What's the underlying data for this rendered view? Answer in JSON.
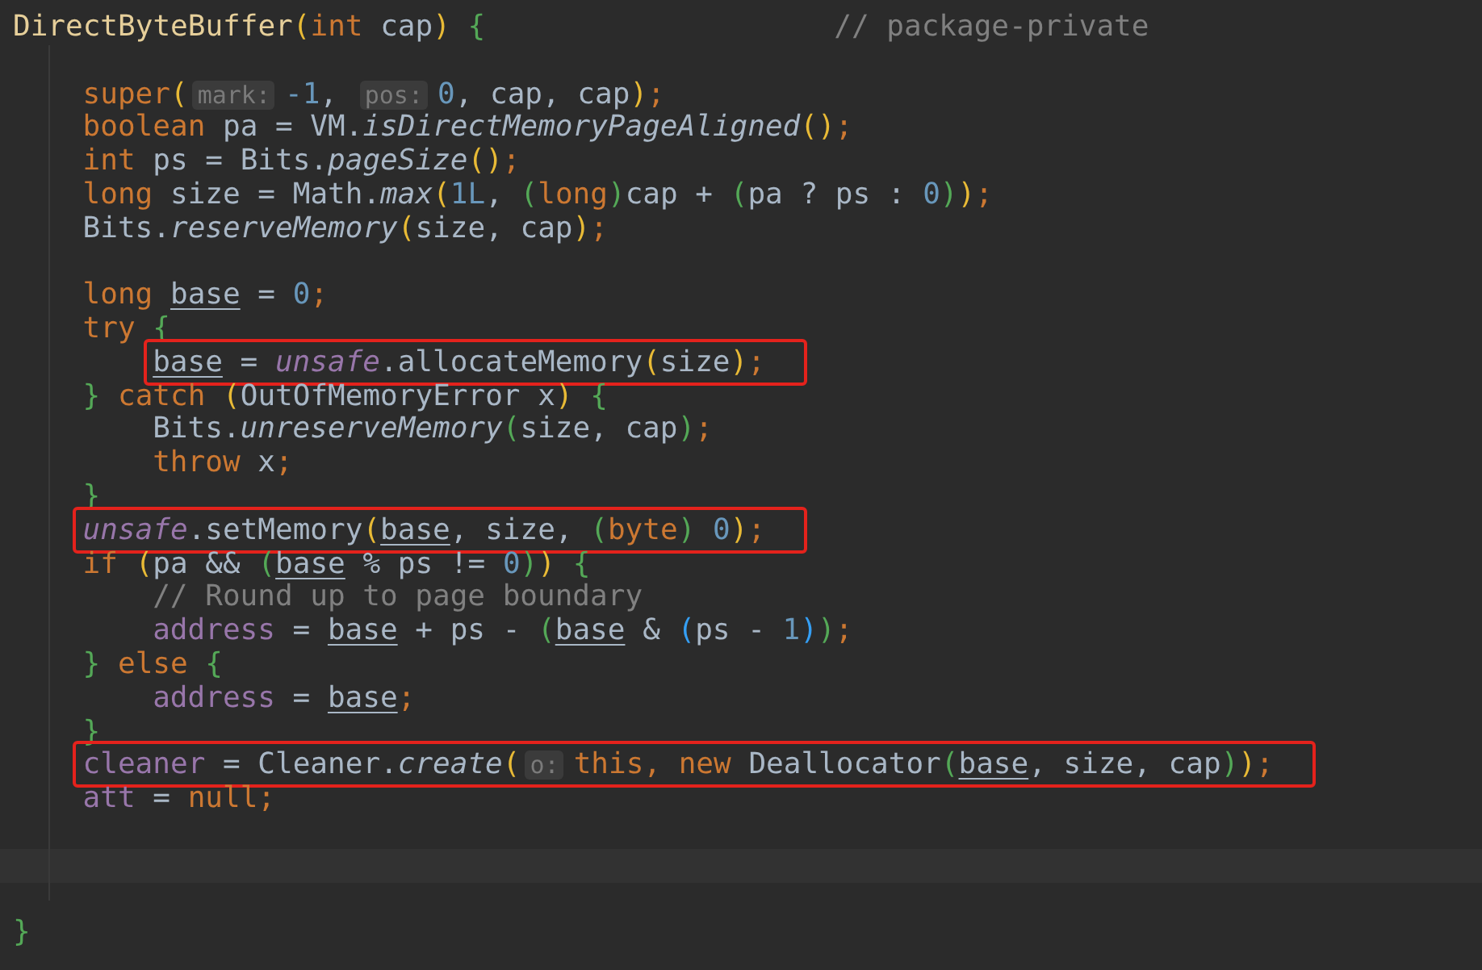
{
  "editor": {
    "lines": [
      {
        "kind": "code",
        "highlighted": false,
        "tokens": [
          {
            "kind": "fn",
            "text": "DirectByteBuffer"
          },
          {
            "kind": "b1",
            "text": "("
          },
          {
            "kind": "kw",
            "text": "int"
          },
          {
            "kind": "id",
            "text": " cap"
          },
          {
            "kind": "b1",
            "text": ")"
          },
          {
            "kind": "b2",
            "text": " {"
          }
        ],
        "comment": "// package-private",
        "children": [
          {
            "kind": "blank"
          },
          {
            "kind": "code",
            "highlighted": false,
            "tokens": [
              {
                "kind": "kw",
                "text": "super"
              },
              {
                "kind": "b1",
                "text": "("
              },
              {
                "kind": "hint",
                "text": "mark:"
              },
              {
                "kind": "num",
                "text": "-1"
              },
              {
                "kind": "id",
                "text": ", "
              },
              {
                "kind": "hint",
                "text": "pos:"
              },
              {
                "kind": "num",
                "text": "0"
              },
              {
                "kind": "id",
                "text": ", cap, cap"
              },
              {
                "kind": "b1",
                "text": ")"
              },
              {
                "kind": "kw",
                "text": ";"
              }
            ]
          },
          {
            "kind": "code",
            "highlighted": false,
            "tokens": [
              {
                "kind": "kw",
                "text": "boolean"
              },
              {
                "kind": "id",
                "text": " pa = VM."
              },
              {
                "kind": "ital",
                "text": "isDirectMemoryPageAligned"
              },
              {
                "kind": "b1",
                "text": "()"
              },
              {
                "kind": "kw",
                "text": ";"
              }
            ]
          },
          {
            "kind": "code",
            "highlighted": false,
            "tokens": [
              {
                "kind": "kw",
                "text": "int"
              },
              {
                "kind": "id",
                "text": " ps = Bits."
              },
              {
                "kind": "ital",
                "text": "pageSize"
              },
              {
                "kind": "b1",
                "text": "()"
              },
              {
                "kind": "kw",
                "text": ";"
              }
            ]
          },
          {
            "kind": "code",
            "highlighted": false,
            "tokens": [
              {
                "kind": "kw",
                "text": "long"
              },
              {
                "kind": "id",
                "text": " size = Math."
              },
              {
                "kind": "ital",
                "text": "max"
              },
              {
                "kind": "b1",
                "text": "("
              },
              {
                "kind": "num",
                "text": "1L"
              },
              {
                "kind": "id",
                "text": ", "
              },
              {
                "kind": "b2",
                "text": "("
              },
              {
                "kind": "kw",
                "text": "long"
              },
              {
                "kind": "b2",
                "text": ")"
              },
              {
                "kind": "id",
                "text": "cap + "
              },
              {
                "kind": "b2",
                "text": "("
              },
              {
                "kind": "id",
                "text": "pa ? ps : "
              },
              {
                "kind": "num",
                "text": "0"
              },
              {
                "kind": "b2",
                "text": ")"
              },
              {
                "kind": "b1",
                "text": ")"
              },
              {
                "kind": "kw",
                "text": ";"
              }
            ]
          },
          {
            "kind": "code",
            "highlighted": false,
            "tokens": [
              {
                "kind": "id",
                "text": "Bits."
              },
              {
                "kind": "ital",
                "text": "reserveMemory"
              },
              {
                "kind": "b1",
                "text": "("
              },
              {
                "kind": "id",
                "text": "size, cap"
              },
              {
                "kind": "b1",
                "text": ")"
              },
              {
                "kind": "kw",
                "text": ";"
              }
            ]
          },
          {
            "kind": "blank"
          },
          {
            "kind": "code",
            "highlighted": false,
            "tokens": [
              {
                "kind": "kw",
                "text": "long "
              },
              {
                "kind": "under",
                "text": "base"
              },
              {
                "kind": "id",
                "text": " = "
              },
              {
                "kind": "num",
                "text": "0"
              },
              {
                "kind": "kw",
                "text": ";"
              }
            ]
          },
          {
            "kind": "code",
            "highlighted": false,
            "tokens": [
              {
                "kind": "kw",
                "text": "try"
              },
              {
                "kind": "b2",
                "text": " {"
              }
            ],
            "children": [
              {
                "kind": "code",
                "highlighted": true,
                "tokens": [
                  {
                    "kind": "under",
                    "text": "base"
                  },
                  {
                    "kind": "id",
                    "text": " = "
                  },
                  {
                    "kind": "fieldital",
                    "text": "unsafe"
                  },
                  {
                    "kind": "id",
                    "text": ".allocateMemory"
                  },
                  {
                    "kind": "b1",
                    "text": "("
                  },
                  {
                    "kind": "id",
                    "text": "size"
                  },
                  {
                    "kind": "b1",
                    "text": ")"
                  },
                  {
                    "kind": "kw",
                    "text": ";"
                  }
                ]
              }
            ]
          },
          {
            "kind": "code",
            "highlighted": false,
            "tokens": [
              {
                "kind": "b2",
                "text": "}"
              },
              {
                "kind": "kw",
                "text": " catch"
              },
              {
                "kind": "b1",
                "text": " ("
              },
              {
                "kind": "id",
                "text": "OutOfMemoryError x"
              },
              {
                "kind": "b1",
                "text": ")"
              },
              {
                "kind": "b2",
                "text": " {"
              }
            ],
            "children": [
              {
                "kind": "code",
                "highlighted": false,
                "tokens": [
                  {
                    "kind": "id",
                    "text": "Bits."
                  },
                  {
                    "kind": "ital",
                    "text": "unreserveMemory"
                  },
                  {
                    "kind": "b2",
                    "text": "("
                  },
                  {
                    "kind": "id",
                    "text": "size, cap"
                  },
                  {
                    "kind": "b2",
                    "text": ")"
                  },
                  {
                    "kind": "kw",
                    "text": ";"
                  }
                ]
              },
              {
                "kind": "code",
                "highlighted": false,
                "tokens": [
                  {
                    "kind": "kw",
                    "text": "throw"
                  },
                  {
                    "kind": "id",
                    "text": " x"
                  },
                  {
                    "kind": "kw",
                    "text": ";"
                  }
                ]
              }
            ]
          },
          {
            "kind": "code",
            "highlighted": false,
            "tokens": [
              {
                "kind": "b2",
                "text": "}"
              }
            ]
          },
          {
            "kind": "code",
            "highlighted": true,
            "tokens": [
              {
                "kind": "fieldital",
                "text": "unsafe"
              },
              {
                "kind": "id",
                "text": ".setMemory"
              },
              {
                "kind": "b1",
                "text": "("
              },
              {
                "kind": "under",
                "text": "base"
              },
              {
                "kind": "id",
                "text": ", size, "
              },
              {
                "kind": "b2",
                "text": "("
              },
              {
                "kind": "kw",
                "text": "byte"
              },
              {
                "kind": "b2",
                "text": ")"
              },
              {
                "kind": "num",
                "text": " 0"
              },
              {
                "kind": "b1",
                "text": ")"
              },
              {
                "kind": "kw",
                "text": ";"
              }
            ]
          },
          {
            "kind": "code",
            "highlighted": false,
            "tokens": [
              {
                "kind": "kw",
                "text": "if"
              },
              {
                "kind": "b1",
                "text": " ("
              },
              {
                "kind": "id",
                "text": "pa && "
              },
              {
                "kind": "b2",
                "text": "("
              },
              {
                "kind": "under",
                "text": "base"
              },
              {
                "kind": "id",
                "text": " % ps != "
              },
              {
                "kind": "num",
                "text": "0"
              },
              {
                "kind": "b2",
                "text": ")"
              },
              {
                "kind": "b1",
                "text": ")"
              },
              {
                "kind": "b2",
                "text": " {"
              }
            ],
            "children": [
              {
                "kind": "code",
                "highlighted": false,
                "tokens": [
                  {
                    "kind": "comment",
                    "text": "// Round up to page boundary"
                  }
                ]
              },
              {
                "kind": "code",
                "highlighted": false,
                "tokens": [
                  {
                    "kind": "field",
                    "text": "address"
                  },
                  {
                    "kind": "id",
                    "text": " = "
                  },
                  {
                    "kind": "under",
                    "text": "base"
                  },
                  {
                    "kind": "id",
                    "text": " + ps - "
                  },
                  {
                    "kind": "b2",
                    "text": "("
                  },
                  {
                    "kind": "under",
                    "text": "base"
                  },
                  {
                    "kind": "id",
                    "text": " & "
                  },
                  {
                    "kind": "b3",
                    "text": "("
                  },
                  {
                    "kind": "id",
                    "text": "ps - "
                  },
                  {
                    "kind": "num",
                    "text": "1"
                  },
                  {
                    "kind": "b3",
                    "text": ")"
                  },
                  {
                    "kind": "b2",
                    "text": ")"
                  },
                  {
                    "kind": "kw",
                    "text": ";"
                  }
                ]
              }
            ]
          },
          {
            "kind": "code",
            "highlighted": false,
            "tokens": [
              {
                "kind": "b2",
                "text": "}"
              },
              {
                "kind": "kw",
                "text": " else"
              },
              {
                "kind": "b2",
                "text": " {"
              }
            ],
            "children": [
              {
                "kind": "code",
                "highlighted": false,
                "tokens": [
                  {
                    "kind": "field",
                    "text": "address"
                  },
                  {
                    "kind": "id",
                    "text": " = "
                  },
                  {
                    "kind": "under",
                    "text": "base"
                  },
                  {
                    "kind": "kw",
                    "text": ";"
                  }
                ]
              }
            ]
          },
          {
            "kind": "code",
            "highlighted": false,
            "tokens": [
              {
                "kind": "b2",
                "text": "}"
              }
            ]
          },
          {
            "kind": "code",
            "highlighted": true,
            "tokens": [
              {
                "kind": "field",
                "text": "cleaner"
              },
              {
                "kind": "id",
                "text": " = Cleaner."
              },
              {
                "kind": "ital",
                "text": "create"
              },
              {
                "kind": "b1",
                "text": "("
              },
              {
                "kind": "hint",
                "text": "o:"
              },
              {
                "kind": "kw",
                "text": "this, new "
              },
              {
                "kind": "id",
                "text": "Deallocator"
              },
              {
                "kind": "b2",
                "text": "("
              },
              {
                "kind": "under",
                "text": "base"
              },
              {
                "kind": "id",
                "text": ", size, cap"
              },
              {
                "kind": "b2",
                "text": ")"
              },
              {
                "kind": "b1",
                "text": ")"
              },
              {
                "kind": "kw",
                "text": ";"
              }
            ]
          },
          {
            "kind": "code",
            "highlighted": false,
            "tokens": [
              {
                "kind": "field",
                "text": "att"
              },
              {
                "kind": "id",
                "text": " = "
              },
              {
                "kind": "kw",
                "text": "null;"
              }
            ]
          },
          {
            "kind": "blank"
          },
          {
            "kind": "cursor"
          },
          {
            "kind": "blank"
          }
        ]
      },
      {
        "kind": "code",
        "highlighted": false,
        "tokens": [
          {
            "kind": "b2",
            "text": "}"
          }
        ]
      }
    ]
  }
}
